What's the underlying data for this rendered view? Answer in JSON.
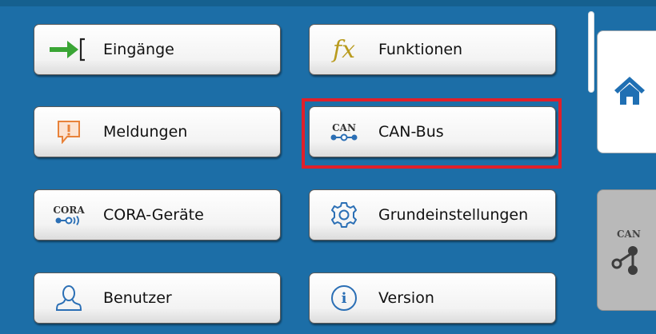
{
  "menu": {
    "inputs_label": "Eingänge",
    "functions_label": "Funktionen",
    "messages_label": "Meldungen",
    "canbus_label": "CAN-Bus",
    "cora_label": "CORA-Geräte",
    "settings_label": "Grundeinstellungen",
    "user_label": "Benutzer",
    "version_label": "Version"
  },
  "icons": {
    "inputs": "input-arrow-icon",
    "functions": "fx-icon",
    "messages": "message-warning-icon",
    "canbus": "can-bus-icon",
    "cora": "cora-wireless-icon",
    "settings": "gear-icon",
    "user": "user-icon",
    "version": "info-icon",
    "home": "home-icon",
    "can_side": "can-network-icon"
  },
  "icon_text": {
    "functions": "fx",
    "can": "CAN",
    "cora": "CORA",
    "info": "i",
    "can_side": "CAN"
  },
  "colors": {
    "background": "#1c6ea7",
    "highlight": "#e0202a",
    "arrow_green": "#3aa535",
    "fx_gold": "#b99b1e",
    "message_orange": "#e8823a",
    "icon_blue": "#2b6fb5",
    "home_blue": "#1f6fb3"
  }
}
